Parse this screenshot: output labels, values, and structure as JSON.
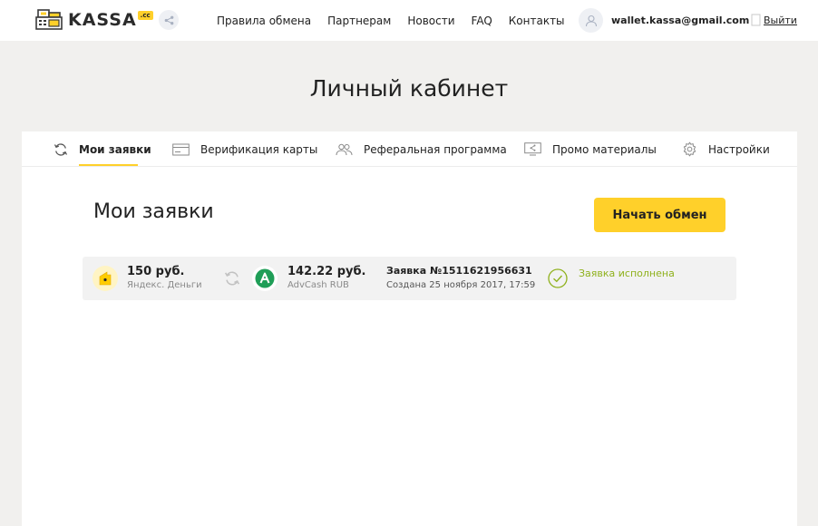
{
  "header": {
    "logo_text": "KASSA",
    "logo_badge": ".cc",
    "nav": [
      "Правила обмена",
      "Партнерам",
      "Новости",
      "FAQ",
      "Контакты"
    ],
    "user_email": "wallet.kassa@gmail.com",
    "logout_label": "Выйти"
  },
  "page_title": "Личный кабинет",
  "tabs": [
    {
      "label": "Мои заявки",
      "icon": "refresh-icon",
      "active": true
    },
    {
      "label": "Верификация карты",
      "icon": "card-icon",
      "active": false
    },
    {
      "label": "Реферальная программа",
      "icon": "users-icon",
      "active": false
    },
    {
      "label": "Промо материалы",
      "icon": "monitor-share-icon",
      "active": false
    },
    {
      "label": "Настройки",
      "icon": "gear-icon",
      "active": false
    }
  ],
  "section": {
    "title": "Мои заявки",
    "start_button": "Начать обмен"
  },
  "order": {
    "from_amount": "150 руб.",
    "from_currency": "Яндекс. Деньги",
    "to_amount": "142.22 руб.",
    "to_currency": "AdvCash RUB",
    "order_number": "Заявка №1511621956631",
    "created": "Создана 25 ноября 2017, 17:59",
    "status": "Заявка исполнена"
  },
  "colors": {
    "accent": "#ffd02a",
    "background": "#f1f0ee",
    "status_green": "#8fb11c",
    "advcash_green": "#1f9e57"
  }
}
